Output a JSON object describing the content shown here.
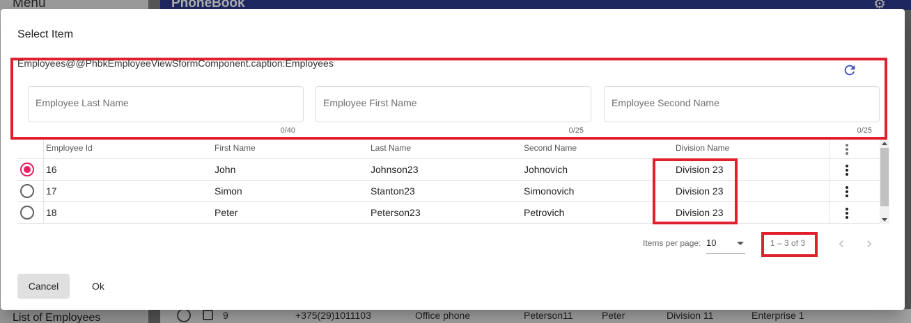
{
  "background": {
    "menu_title": "Menu",
    "app_title": "PhoneBook",
    "gear_icon": "gear-icon",
    "list_of_employees": "List of Employees",
    "row": {
      "id": "9",
      "phone": "+375(29)1011103",
      "phone_type": "Office phone",
      "last_name": "Peterson11",
      "first_name": "Peter",
      "division": "Division 11",
      "enterprise": "Enterprise 1"
    }
  },
  "dialog": {
    "title": "Select Item",
    "caption": "Employees@@PhbkEmployeeViewSformComponent.caption:Employees",
    "refresh_icon": "refresh-icon",
    "filters": [
      {
        "placeholder": "Employee Last Name",
        "value": "",
        "counter": "0/40"
      },
      {
        "placeholder": "Employee First Name",
        "value": "",
        "counter": "0/25"
      },
      {
        "placeholder": "Employee Second Name",
        "value": "",
        "counter": "0/25"
      }
    ],
    "table": {
      "headers": [
        "Employee Id",
        "First Name",
        "Last Name",
        "Second Name",
        "Division Name"
      ],
      "rows": [
        {
          "selected": true,
          "id": "16",
          "first": "John",
          "last": "Johnson23",
          "second": "Johnovich",
          "division": "Division 23"
        },
        {
          "selected": false,
          "id": "17",
          "first": "Simon",
          "last": "Stanton23",
          "second": "Simonovich",
          "division": "Division 23"
        },
        {
          "selected": false,
          "id": "18",
          "first": "Peter",
          "last": "Peterson23",
          "second": "Petrovich",
          "division": "Division 23"
        }
      ]
    },
    "paginator": {
      "items_per_page_label": "Items per page:",
      "page_size": "10",
      "range_label": "1 – 3 of 3"
    },
    "actions": {
      "cancel": "Cancel",
      "ok": "Ok"
    }
  },
  "colors": {
    "highlight": "#e0202c",
    "radio_selected": "#e91e63",
    "toolbar": "#2d3a8c",
    "refresh": "#3f51b5"
  }
}
